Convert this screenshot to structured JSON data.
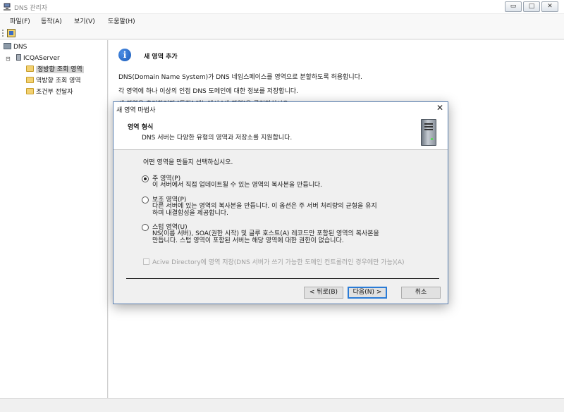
{
  "window": {
    "title": "DNS 관리자",
    "controls": [
      "▭",
      "□",
      "✕"
    ]
  },
  "menu": [
    "파일(F)",
    "동작(A)",
    "보기(V)",
    "도움말(H)"
  ],
  "tree": {
    "root": "DNS",
    "server": "ICQAServer",
    "items": [
      "정방향 조회 영역",
      "역방향 조회 영역",
      "조건부 전달자"
    ]
  },
  "right": {
    "heading": "새 영역 추가",
    "para1": "DNS(Domain Name System)가 DNS 네임스페이스를 영역으로 분할하도록 허용합니다.",
    "para2": "각 영역에 하나 이상의 인접 DNS 도메인에 대한 정보를 저장합니다.",
    "para3": "새 영역을 추가하려면 [동작] 메뉴에서 [새 영역]을 클릭하십시오."
  },
  "dialog": {
    "title": "새 영역 마법사",
    "close": "✕",
    "header_title": "영역 형식",
    "header_desc": "DNS 서버는 다양한 유형의 영역과 저장소를 지원합니다.",
    "question": "어떤 영역을 만들지 선택하십시오.",
    "options": [
      {
        "label": "주 영역(P)",
        "desc": "이 서버에서 직접 업데이트될 수 있는 영역의 복사본을 만듭니다.",
        "selected": true
      },
      {
        "label": "보조 영역(P)",
        "desc": "다른 서버에 있는 영역의 복사본을 만듭니다. 이 옵션은 주 서버 처리량의 균형을 유지\n하며 내결함성을 제공합니다.",
        "selected": false
      },
      {
        "label": "스텁 영역(U)",
        "desc": "NS(이름 서버), SOA(권한 시작) 및 글루 호스트(A) 레코드만 포함된 영역의 복사본을\n만듭니다. 스텁 영역이 포함된 서버는 해당 영역에 대한 권한이 없습니다.",
        "selected": false
      }
    ],
    "checkbox": "Acive Directory에 영역 저장(DNS 서버가 쓰기 가능한 도메인 컨트롤러인 경우에만 가능)(A)",
    "buttons": {
      "back": "< 뒤로(B)",
      "next": "다음(N) >",
      "cancel": "취소"
    }
  }
}
